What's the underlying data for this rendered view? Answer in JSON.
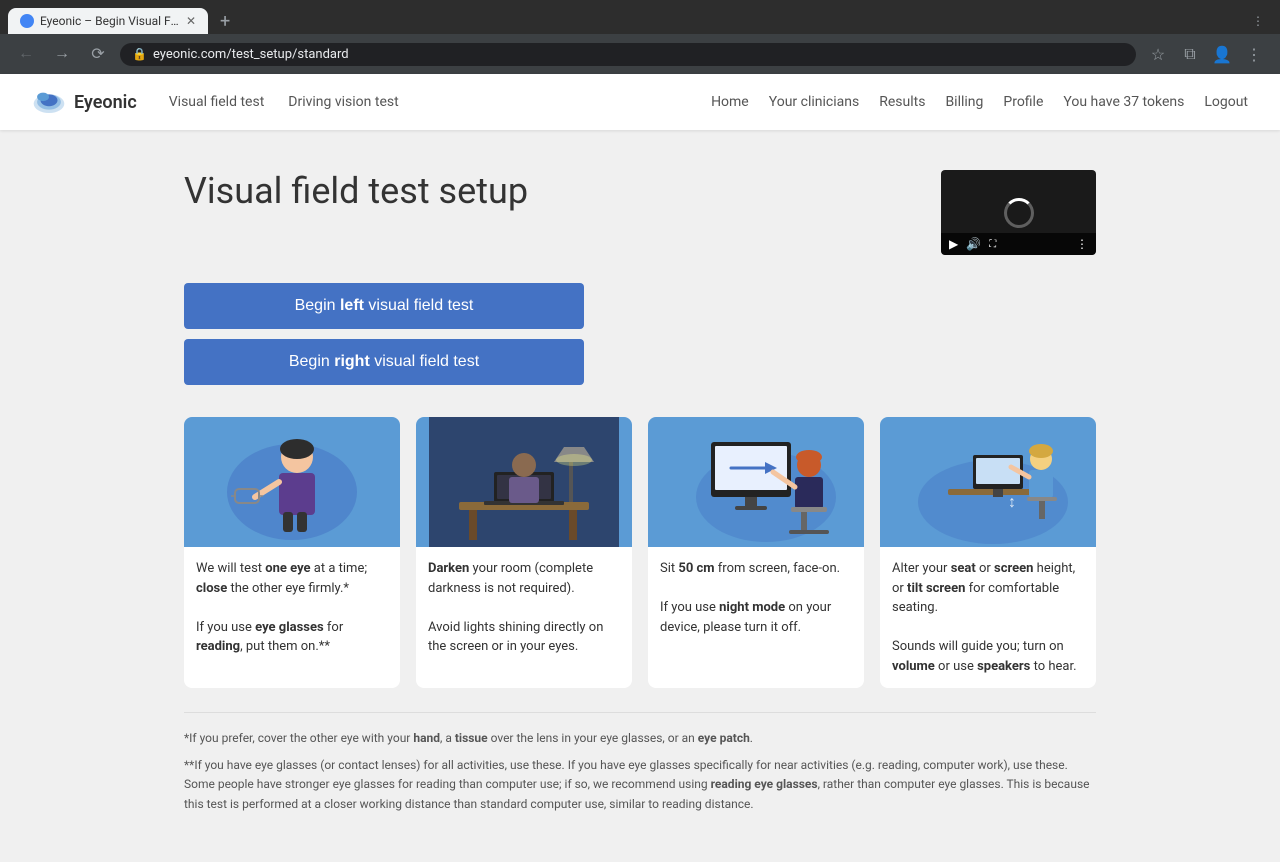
{
  "browser": {
    "tab_title": "Eyeonic – Begin Visual Field Te...",
    "address": "eyeonic.com/test_setup/standard",
    "tab_favicon_color": "#4285f4"
  },
  "nav": {
    "logo_text": "Eyeonic",
    "links_left": [
      {
        "label": "Visual field test",
        "href": "#"
      },
      {
        "label": "Driving vision test",
        "href": "#"
      }
    ],
    "links_right": [
      {
        "label": "Home",
        "href": "#"
      },
      {
        "label": "Your clinicians",
        "href": "#"
      },
      {
        "label": "Results",
        "href": "#"
      },
      {
        "label": "Billing",
        "href": "#"
      },
      {
        "label": "Profile",
        "href": "#"
      },
      {
        "label": "You have 37 tokens",
        "href": "#"
      },
      {
        "label": "Logout",
        "href": "#"
      }
    ]
  },
  "page": {
    "title": "Visual field test setup",
    "btn_left_label_prefix": "Begin ",
    "btn_left_bold": "left",
    "btn_left_label_suffix": " visual field test",
    "btn_right_label_prefix": "Begin ",
    "btn_right_bold": "right",
    "btn_right_label_suffix": " visual field test"
  },
  "cards": [
    {
      "body_html": "We will test <strong>one eye</strong> at a time; <strong>close</strong> the other eye firmly.*<br><br>If you use <strong>eye glasses</strong> for <strong>reading</strong>, put them on.**"
    },
    {
      "body_html": "<strong>Darken</strong> your room (complete darkness is not required).<br><br>Avoid lights shining directly on the screen or in your eyes."
    },
    {
      "body_html": "Sit <strong>50 cm</strong> from screen, face-on.<br><br>If you use <strong>night mode</strong> on your device, please turn it off."
    },
    {
      "body_html": "Alter your <strong>seat</strong> or <strong>screen</strong> height, or <strong>tilt screen</strong> for comfortable seating.<br><br>Sounds will guide you; turn on <strong>volume</strong> or use <strong>speakers</strong> to hear."
    }
  ],
  "footnotes": [
    "*If you prefer, cover the other eye with your <strong>hand</strong>, a <strong>tissue</strong> over the lens in your eye glasses, or an <strong>eye patch</strong>.",
    "**If you have eye glasses (or contact lenses) for all activities, use these. If you have eye glasses specifically for near activities (e.g. reading, computer work), use these. Some people have stronger eye glasses for reading than computer use; if so, we recommend using <strong>reading eye glasses</strong>, rather than computer eye glasses. This is because this test is performed at a closer working distance than standard computer use, similar to reading distance."
  ],
  "colors": {
    "button_bg": "#4472C4",
    "card_bg": "#5b9bd5",
    "nav_bg": "#ffffff"
  }
}
